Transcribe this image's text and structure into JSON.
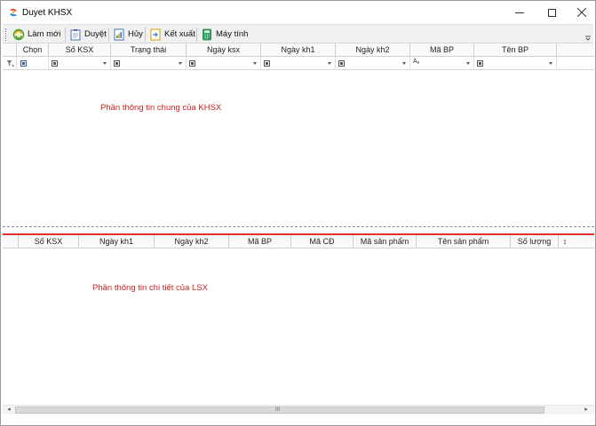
{
  "window": {
    "title": "Duyet KHSX"
  },
  "toolbar": {
    "buttons": [
      {
        "label": "Làm mới",
        "icon": "refresh-icon"
      },
      {
        "label": "Duyệt",
        "icon": "clipboard-icon"
      },
      {
        "label": "Hủy",
        "icon": "chart-icon"
      },
      {
        "label": "Kết xuất",
        "icon": "export-icon"
      },
      {
        "label": "Máy tính",
        "icon": "calculator-icon"
      }
    ]
  },
  "top_grid": {
    "columns": [
      "Chọn",
      "Số KSX",
      "Trạng thái",
      "Ngày ksx",
      "Ngày kh1",
      "Ngày kh2",
      "Mã BP",
      "Tên BP"
    ],
    "note": "Phần thông tin chung của KHSX"
  },
  "bottom_grid": {
    "columns": [
      "Số KSX",
      "Ngày kh1",
      "Ngày kh2",
      "Mã BP",
      "Mã CĐ",
      "Mã sản phẩm",
      "Tên sản phẩm",
      "Số lượng"
    ],
    "note": "Phần thông tin chi tiết của LSX",
    "scroll_glyph": "↕"
  },
  "hscroll": {
    "left": "◂",
    "right": "▸",
    "grip": "III"
  },
  "colors": {
    "accent_red": "#cc2222",
    "splitter": "#e03030",
    "toolbar_bg": "#f0f0f0"
  }
}
